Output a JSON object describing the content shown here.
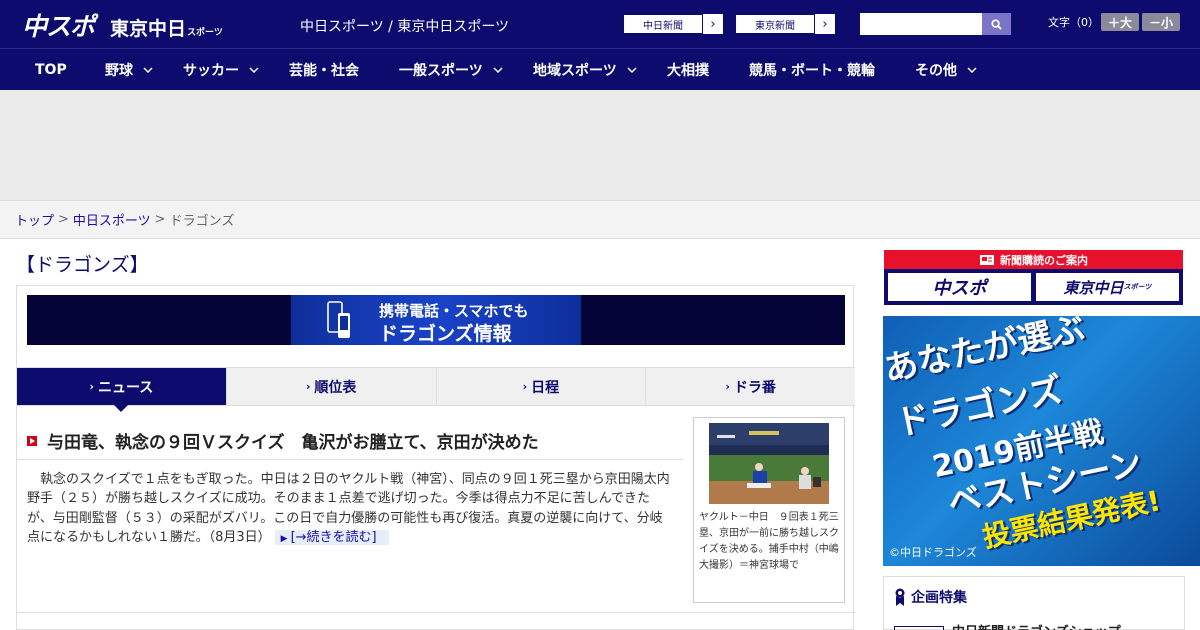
{
  "header": {
    "logo_main": "中スポ",
    "logo_tokyo": "東京中日",
    "logo_tokyo_small": "スポーツ",
    "site_title": "中日スポーツ / 東京中日スポーツ",
    "paper_links": [
      "中日新聞",
      "東京新聞"
    ],
    "search": {
      "value": "",
      "placeholder": ""
    },
    "font_size_label": "文字（0）",
    "font_larger": "＋大",
    "font_smaller": "－小"
  },
  "nav": {
    "items": [
      {
        "label": "TOP",
        "dropdown": false
      },
      {
        "label": "野球",
        "dropdown": true
      },
      {
        "label": "サッカー",
        "dropdown": true
      },
      {
        "label": "芸能・社会",
        "dropdown": false
      },
      {
        "label": "一般スポーツ",
        "dropdown": true
      },
      {
        "label": "地域スポーツ",
        "dropdown": true
      },
      {
        "label": "大相撲",
        "dropdown": false
      },
      {
        "label": "競馬・ボート・競輪",
        "dropdown": false
      },
      {
        "label": "その他",
        "dropdown": true
      }
    ]
  },
  "breadcrumb": {
    "items": [
      "トップ",
      "中日スポーツ",
      "ドラゴンズ"
    ],
    "separator": ">"
  },
  "page": {
    "title": "【ドラゴンズ】"
  },
  "promo": {
    "line1": "携帯電話・スマホでも",
    "line2": "ドラゴンズ情報"
  },
  "tabs": [
    {
      "label": "ニュース",
      "active": true
    },
    {
      "label": "順位表",
      "active": false
    },
    {
      "label": "日程",
      "active": false
    },
    {
      "label": "ドラ番",
      "active": false
    }
  ],
  "article": {
    "headline": "与田竜、執念の９回Ｖスクイズ　亀沢がお膳立て、京田が決めた",
    "body": "執念のスクイズで１点をもぎ取った。中日は２日のヤクルト戦（神宮）、同点の９回１死三塁から京田陽太内野手（２５）が勝ち越しスクイズに成功。そのまま１点差で逃げ切った。今季は得点力不足に苦しんできたが、与田剛監督（５３）の采配がズバリ。この日で自力優勝の可能性も再び復活。真夏の逆襲に向けて、分岐点になるかもしれない１勝だ。",
    "date": "（8月3日）",
    "read_more": "[→続きを読む]",
    "photo_caption": "ヤクルト－中日　９回表１死三塁、京田が一前に勝ち越しスクイズを決める。捕手中村（中嶋大撮影）＝神宮球場で"
  },
  "sidebar": {
    "subscribe_title": "新聞購読のご案内",
    "subscribe_logos": [
      "中スポ",
      "東京中日"
    ],
    "subscribe_logo_small": "スポーツ",
    "vote_banner": {
      "line1": "あなたが選ぶ",
      "line2": "ドラゴンズ",
      "line3": "2019前半戦",
      "line4": "ベストシーン",
      "line5": "投票結果発表!",
      "copyright": "©中日ドラゴンズ"
    },
    "feature_title": "企画特集",
    "feature_item": "中日新聞ドラゴンズショップ"
  },
  "colors": {
    "brand_navy": "#0d0b6e",
    "accent_red": "#e8112d",
    "link_blue": "#1a0dab"
  }
}
